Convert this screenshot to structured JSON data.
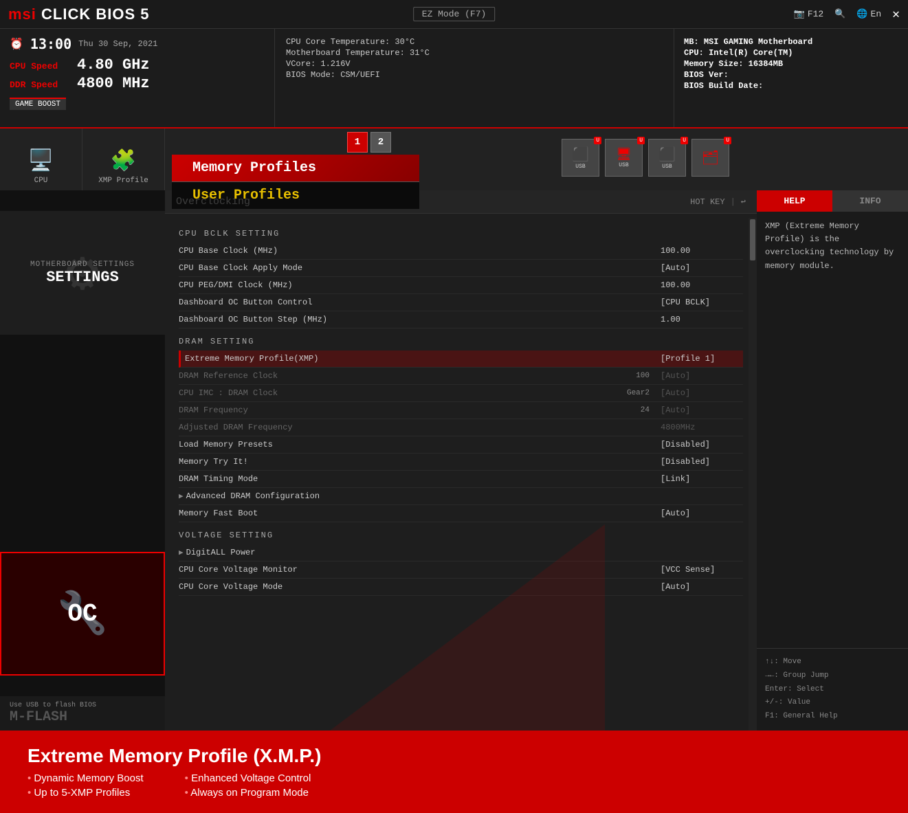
{
  "app": {
    "title": "MSI CLICK BIOS 5",
    "ez_mode": "EZ Mode (F7)",
    "f12_label": "F12",
    "lang_label": "En",
    "close": "✕"
  },
  "status": {
    "clock_icon": "⏰",
    "time": "13:00",
    "date": "Thu 30 Sep, 2021",
    "cpu_speed_label": "CPU Speed",
    "cpu_speed_value": "4.80 GHz",
    "ddr_speed_label": "DDR Speed",
    "ddr_speed_value": "4800 MHz",
    "game_boost": "GAME BOOST",
    "cpu_temp": "CPU Core Temperature: 30°C",
    "mb_temp": "Motherboard Temperature: 31°C",
    "vcore": "VCore: 1.216V",
    "bios_mode": "BIOS Mode: CSM/UEFI",
    "mb_label": "MB:",
    "mb_value": "MSI GAMING Motherboard",
    "cpu_label": "CPU:",
    "cpu_value": "Intel(R) Core(TM)",
    "mem_label": "Memory Size:",
    "mem_value": "16384MB",
    "bios_ver_label": "BIOS Ver:",
    "bios_ver_value": "",
    "bios_build_label": "BIOS Build Date:",
    "bios_build_value": ""
  },
  "nav": {
    "cpu_label": "CPU",
    "xmp_label": "XMP Profile",
    "memory_profiles": "Memory Profiles",
    "user_profiles": "User Profiles"
  },
  "xmp_buttons": [
    "1",
    "2"
  ],
  "sidebar": {
    "settings_sub": "Motherboard settings",
    "settings_title": "SETTINGS",
    "oc_title": "OC",
    "mflash_sub": "Use USB to flash BIOS",
    "mflash_title": "M-FLASH"
  },
  "overclocking": {
    "title": "Overclocking",
    "hotkey": "HOT KEY",
    "sections": {
      "cpu_bclk": "CPU BCLK Setting",
      "dram": "DRAM Setting",
      "voltage": "Voltage Setting"
    },
    "settings": [
      {
        "name": "CPU Base Clock (MHz)",
        "sub": "",
        "value": "100.00",
        "highlighted": false,
        "dimmed": false
      },
      {
        "name": "CPU Base Clock Apply Mode",
        "sub": "",
        "value": "[Auto]",
        "highlighted": false,
        "dimmed": false
      },
      {
        "name": "CPU PEG/DMI Clock (MHz)",
        "sub": "",
        "value": "100.00",
        "highlighted": false,
        "dimmed": false
      },
      {
        "name": "Dashboard OC Button Control",
        "sub": "",
        "value": "[CPU BCLK]",
        "highlighted": false,
        "dimmed": false
      },
      {
        "name": "Dashboard OC Button Step (MHz)",
        "sub": "",
        "value": "1.00",
        "highlighted": false,
        "dimmed": false
      }
    ],
    "dram_settings": [
      {
        "name": "Extreme Memory Profile(XMP)",
        "sub": "",
        "value": "[Profile 1]",
        "highlighted": true,
        "dimmed": false
      },
      {
        "name": "DRAM Reference Clock",
        "sub": "100",
        "value": "[Auto]",
        "highlighted": false,
        "dimmed": true
      },
      {
        "name": "CPU IMC : DRAM Clock",
        "sub": "Gear2",
        "value": "[Auto]",
        "highlighted": false,
        "dimmed": true
      },
      {
        "name": "DRAM Frequency",
        "sub": "24",
        "value": "[Auto]",
        "highlighted": false,
        "dimmed": true
      },
      {
        "name": "Adjusted DRAM Frequency",
        "sub": "",
        "value": "4800MHz",
        "highlighted": false,
        "dimmed": true
      },
      {
        "name": "Load Memory Presets",
        "sub": "",
        "value": "[Disabled]",
        "highlighted": false,
        "dimmed": false
      },
      {
        "name": "Memory Try It!",
        "sub": "",
        "value": "[Disabled]",
        "highlighted": false,
        "dimmed": false
      },
      {
        "name": "DRAM Timing Mode",
        "sub": "",
        "value": "[Link]",
        "highlighted": false,
        "dimmed": false
      },
      {
        "name": "Advanced DRAM Configuration",
        "sub": "",
        "value": "",
        "highlighted": false,
        "dimmed": false,
        "arrow": true
      },
      {
        "name": "Memory Fast Boot",
        "sub": "",
        "value": "[Auto]",
        "highlighted": false,
        "dimmed": false
      }
    ],
    "voltage_settings": [
      {
        "name": "DigitALL Power",
        "sub": "",
        "value": "",
        "highlighted": false,
        "dimmed": false,
        "arrow": true
      },
      {
        "name": "CPU Core Voltage Monitor",
        "sub": "",
        "value": "[VCC Sense]",
        "highlighted": false,
        "dimmed": false
      },
      {
        "name": "CPU Core Voltage Mode",
        "sub": "",
        "value": "[Auto]",
        "highlighted": false,
        "dimmed": false
      }
    ]
  },
  "help": {
    "tab_help": "HELP",
    "tab_info": "INFO",
    "content": "XMP (Extreme Memory Profile) is the overclocking technology by memory module.",
    "keys": [
      "↑↓: Move",
      "→←: Group Jump",
      "Enter: Select",
      "+/-: Value",
      "F1: General Help"
    ]
  },
  "bottom": {
    "title": "Extreme Memory Profile (X.M.P.)",
    "features_left": [
      "Dynamic Memory Boost",
      "Up to 5-XMP Profiles"
    ],
    "features_right": [
      "Enhanced Voltage Control",
      "Always on Program Mode"
    ]
  }
}
